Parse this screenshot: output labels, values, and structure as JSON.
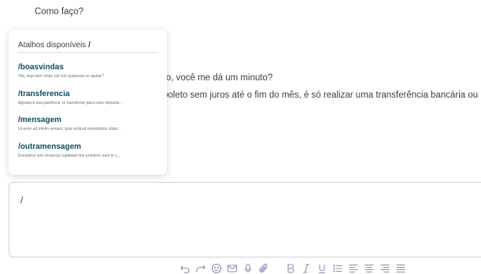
{
  "conversation": {
    "line_top": "Como faço?",
    "line_1": "ro, você me dá um minuto?",
    "line_2": "boleto sem juros até o fim do mês, é só realizar uma transferência bancária ou"
  },
  "shortcuts_popup": {
    "title": "Atalhos disponíveis",
    "trigger": "/",
    "items": [
      {
        "name": "/boasvindas",
        "description": "Olá, seja bem vindo (a)! Em queposso te ajudar?"
      },
      {
        "name": "/transferencia",
        "description": "Agradeço sua paciência, te transferirei para outro departa..."
      },
      {
        "name": "/mensagem",
        "description": "Ut enim ad minim veniam, quis nostrud exercitation ullam..."
      },
      {
        "name": "/outramensagem",
        "description": "Excepteur sint occaecat cupidatat non proident, sunt in c..."
      }
    ]
  },
  "editor": {
    "value": "/"
  },
  "toolbar": {
    "icons": [
      "undo-icon",
      "redo-icon",
      "emoji-icon",
      "email-icon",
      "microphone-icon",
      "attachment-icon",
      "bold-icon",
      "italic-icon",
      "underline-icon",
      "list-icon",
      "align-left-icon",
      "align-center-icon",
      "align-right-icon",
      "align-justify-icon"
    ]
  },
  "colors": {
    "accent": "#0f4c5c",
    "text": "#3a3d42",
    "icon": "#8a8fb0",
    "border": "#cfd2d6"
  }
}
